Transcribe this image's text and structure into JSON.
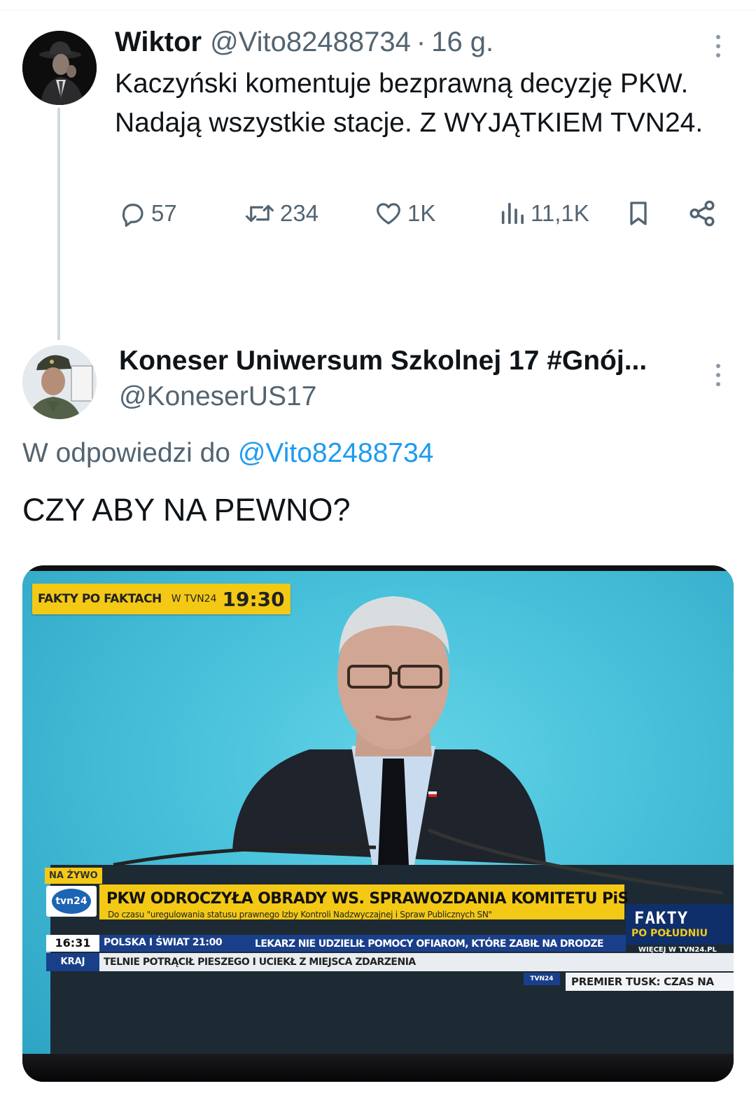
{
  "tweet1": {
    "author_name": "Wiktor",
    "author_handle": "@Vito82488734",
    "separator": "·",
    "time": "16 g.",
    "text": "Kaczyński komentuje bezprawną decyzję PKW. Nadają wszystkie stacje. Z WYJĄTKIEM TVN24.",
    "actions": {
      "replies": "57",
      "reposts": "234",
      "likes": "1K",
      "views": "11,1K"
    },
    "icons": [
      "reply-icon",
      "repost-icon",
      "like-icon",
      "views-icon",
      "bookmark-icon",
      "share-icon",
      "more-icon"
    ]
  },
  "tweet2": {
    "author_name": "Koneser Uniwersum Szkolnej 17 #Gnój...",
    "author_handle": "@KoneserUS17",
    "reply_prefix": "W odpowiedzi do",
    "reply_mention": "@Vito82488734",
    "text": "CZY ABY NA PEWNO?"
  },
  "media": {
    "promo_program": "FAKTY PO FAKTACH",
    "promo_channel": "W TVN24",
    "promo_time": "19:30",
    "live_badge": "NA ŻYWO",
    "channel_logo": "tvn24",
    "headline": "PKW ODROCZYŁA OBRADY WS. SPRAWOZDANIA KOMITETU PiS",
    "subheadline": "Do czasu \"uregulowania statusu prawnego Izby Kontroli Nadzwyczajnej i Spraw Publicznych SN\"",
    "clock": "16:31",
    "program_next": "POLSKA I ŚWIAT 21:00",
    "ticker_top": "LEKARZ NIE UDZIELIŁ POMOCY OFIAROM, KTÓRE ZABIŁ NA DRODZE",
    "section": "KRAJ",
    "ticker_crawl": "TELNIE POTRĄCIŁ PIESZEGO I UCIEKŁ Z MIEJSCA ZDARZENIA",
    "fakty_logo": "FAKTY",
    "fakty_sub": "PO POŁUDNIU",
    "more_link": "WIĘCEJ W TVN24.PL",
    "small_logo": "TVN24",
    "premier_ticker": "PREMIER TUSK: CZAS NA"
  },
  "colors": {
    "text_primary": "#0f1419",
    "text_secondary": "#536471",
    "link": "#1d9bf0",
    "tvn_yellow": "#f3c916",
    "tvn_blue": "#1a3f8a"
  }
}
